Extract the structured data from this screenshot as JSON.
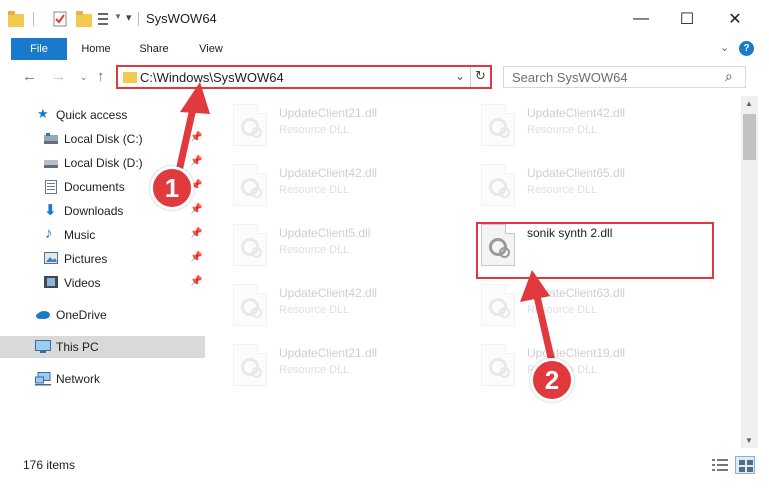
{
  "window": {
    "title": "SysWOW64",
    "minimize_glyph": "—",
    "maximize_glyph": "☐",
    "close_glyph": "✕"
  },
  "ribbon": {
    "tabs": [
      "File",
      "Home",
      "Share",
      "View"
    ],
    "help_glyph": "?"
  },
  "address": {
    "path": "C:\\Windows\\SysWOW64",
    "search_placeholder": "Search SysWOW64"
  },
  "sidebar": {
    "quick_access": "Quick access",
    "items": [
      {
        "label": "Local Disk (C:)",
        "icon": "drive-icon"
      },
      {
        "label": "Local Disk (D:)",
        "icon": "drive-icon"
      },
      {
        "label": "Documents",
        "icon": "documents-icon"
      },
      {
        "label": "Downloads",
        "icon": "downloads-icon"
      },
      {
        "label": "Music",
        "icon": "music-icon"
      },
      {
        "label": "Pictures",
        "icon": "pictures-icon"
      },
      {
        "label": "Videos",
        "icon": "videos-icon"
      }
    ],
    "onedrive": "OneDrive",
    "this_pc": "This PC",
    "network": "Network"
  },
  "files": [
    {
      "name": "UpdateClient21.dll",
      "type": "Resource DLL"
    },
    {
      "name": "UpdateClient42.dll",
      "type": "Resource DLL"
    },
    {
      "name": "UpdateClient42.dll",
      "type": "Resource DLL"
    },
    {
      "name": "UpdateClient65.dll",
      "type": "Resource DLL"
    },
    {
      "name": "UpdateClient5.dll",
      "type": "Resource DLL"
    },
    {
      "name": "sonik synth 2.dll",
      "type": ""
    },
    {
      "name": "UpdateClient42.dll",
      "type": "Resource DLL"
    },
    {
      "name": "UpdateClient63.dll",
      "type": "Resource DLL"
    },
    {
      "name": "UpdateClient21.dll",
      "type": "Resource DLL"
    },
    {
      "name": "UpdateClient19.dll",
      "type": "Resource DLL"
    }
  ],
  "status": {
    "item_count": "176 items"
  },
  "annotations": {
    "marker_1": "1",
    "marker_2": "2",
    "color": "#e0393e"
  }
}
